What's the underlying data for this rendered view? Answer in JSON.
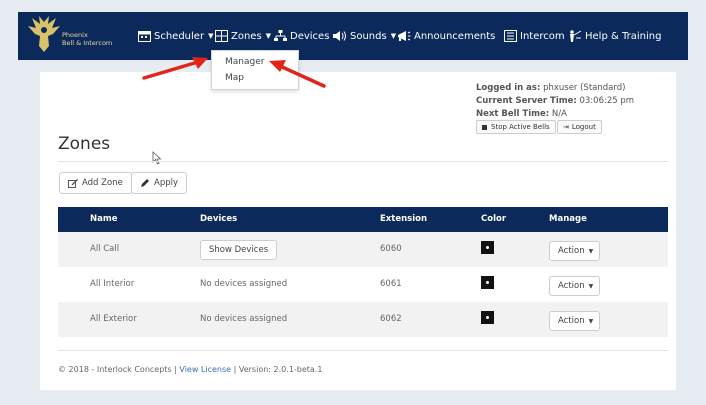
{
  "brand": {
    "line1": "Phoenix",
    "line2": "Bell & Intercom"
  },
  "nav": {
    "scheduler": "Scheduler",
    "zones": "Zones",
    "devices": "Devices",
    "sounds": "Sounds",
    "announcements": "Announcements",
    "intercom": "Intercom",
    "help": "Help & Training"
  },
  "zones_menu": {
    "manager": "Manager",
    "map": "Map"
  },
  "session": {
    "logged_label": "Logged in as:",
    "logged_value": "phxuser (Standard)",
    "time_label": "Current Server Time:",
    "time_value": "03:06:25 pm",
    "bell_label": "Next Bell Time:",
    "bell_value": "N/A",
    "stop_bells": "Stop Active Bells",
    "logout": "Logout"
  },
  "page": {
    "title": "Zones",
    "add_zone": "Add Zone",
    "apply": "Apply"
  },
  "table": {
    "headers": {
      "name": "Name",
      "devices": "Devices",
      "extension": "Extension",
      "color": "Color",
      "manage": "Manage"
    },
    "rows": [
      {
        "name": "All Call",
        "devices": "Show Devices",
        "extension": "6060",
        "color": "#111111",
        "action": "Action"
      },
      {
        "name": "All Interior",
        "devices": "No devices assigned",
        "extension": "6061",
        "color": "#111111",
        "action": "Action"
      },
      {
        "name": "All Exterior",
        "devices": "No devices assigned",
        "extension": "6062",
        "color": "#111111",
        "action": "Action"
      }
    ]
  },
  "footer": {
    "copyright": "© 2018 - Interlock Concepts |",
    "license": "View License",
    "version": "| Version: 2.0.1-beta.1"
  },
  "colors": {
    "navbar": "#0b2a5b",
    "arrow": "#e3241b",
    "link": "#3a6fb5"
  }
}
